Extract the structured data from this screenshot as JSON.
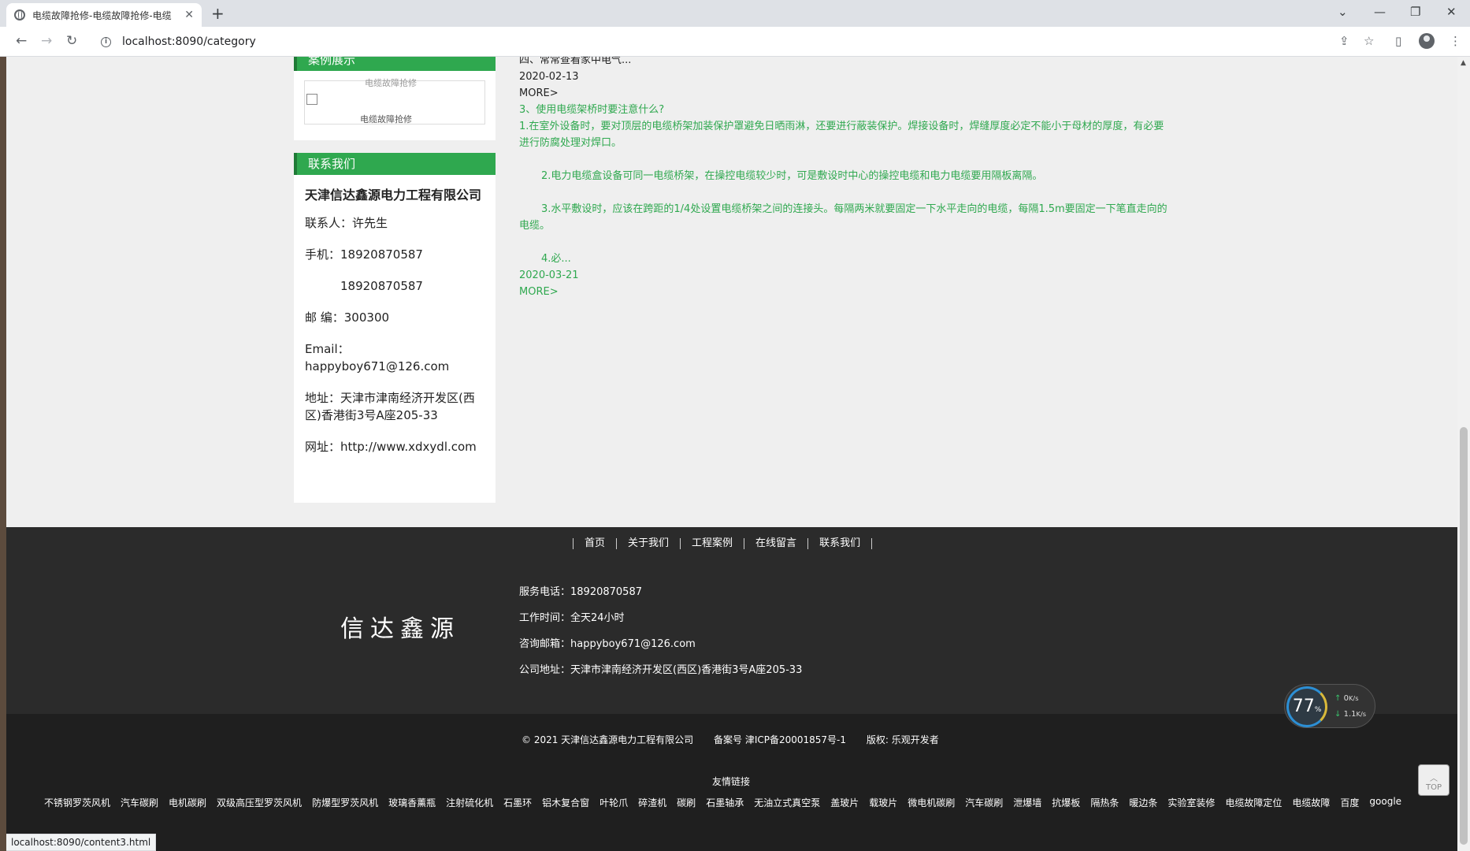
{
  "browser": {
    "tab_title": "电缆故障抢修-电缆故障抢修-电缆",
    "tab_close": "✕",
    "new_tab": "+",
    "url": "localhost:8090/category",
    "status_url": "localhost:8090/content3.html"
  },
  "sidebar": {
    "case_header": "案例展示",
    "case_caption_top": "电缆故障抢修",
    "case_caption": "电缆故障抢修",
    "contact_header": "联系我们",
    "company": "天津信达鑫源电力工程有限公司",
    "contact_person": "联系人：许先生",
    "phone": "手机：18920870587",
    "phone2": "18920870587",
    "postcode": "邮 编：300300",
    "email": "Email：happyboy671@126.com",
    "address": "地址：天津市津南经济开发区(西区)香港街3号A座205-33",
    "website": "网址：http://www.xdxydl.com"
  },
  "articles": {
    "a1_excerpt": "四、常常查看家中电气...",
    "a1_date": "2020-02-13",
    "a1_more": "MORE>",
    "a2_title": "3、使用电缆架桥时要注意什么?",
    "a2_p1": "1.在室外设备时，要对顶层的电缆桥架加装保护罩避免日晒雨淋，还要进行蔽装保护。焊接设备时，焊缝厚度必定不能小于母材的厚度，有必要进行防腐处理对焊口。",
    "a2_p2": "2.电力电缆盒设备可同一电缆桥架，在操控电缆较少时，可是敷设时中心的操控电缆和电力电缆要用隔板离隔。",
    "a2_p3": "3.水平敷设时，应该在跨距的1/4处设置电缆桥架之间的连接头。每隔两米就要固定一下水平走向的电缆，每隔1.5m要固定一下笔直走向的电缆。",
    "a2_p4": "4.必...",
    "a2_date": "2020-03-21",
    "a2_more": "MORE>"
  },
  "footer": {
    "nav": [
      "首页",
      "关于我们",
      "工程案例",
      "在线留言",
      "联系我们"
    ],
    "brand": "信达鑫源",
    "service_phone": "服务电话：18920870587",
    "work_time": "工作时间：全天24小时",
    "email": "咨询邮箱：happyboy671@126.com",
    "address": "公司地址：天津市津南经济开发区(西区)香港街3号A座205-33",
    "copyright": "© 2021 天津信达鑫源电力工程有限公司",
    "icp": "备案号 津ICP备20001857号-1",
    "rights": "版权: 乐观开发者",
    "links_title": "友情链接",
    "links": [
      "不锈钢罗茨风机",
      "汽车碳刷",
      "电机碳刷",
      "双级高压型罗茨风机",
      "防爆型罗茨风机",
      "玻璃香薰瓶",
      "注射硫化机",
      "石墨环",
      "铝木复合窗",
      "叶轮爪",
      "碎渣机",
      "碳刷",
      "石墨轴承",
      "无油立式真空泵",
      "盖玻片",
      "载玻片",
      "微电机碳刷",
      "汽车碳刷",
      "泄爆墙",
      "抗爆板",
      "隔热条",
      "暖边条",
      "实验室装修",
      "电缆故障定位",
      "电缆故障",
      "百度",
      "google"
    ],
    "top_label": "TOP"
  },
  "speed_widget": {
    "percent": "77",
    "percent_unit": "%",
    "up": "0",
    "up_unit": "K/s",
    "down": "1.1",
    "down_unit": "K/s"
  }
}
